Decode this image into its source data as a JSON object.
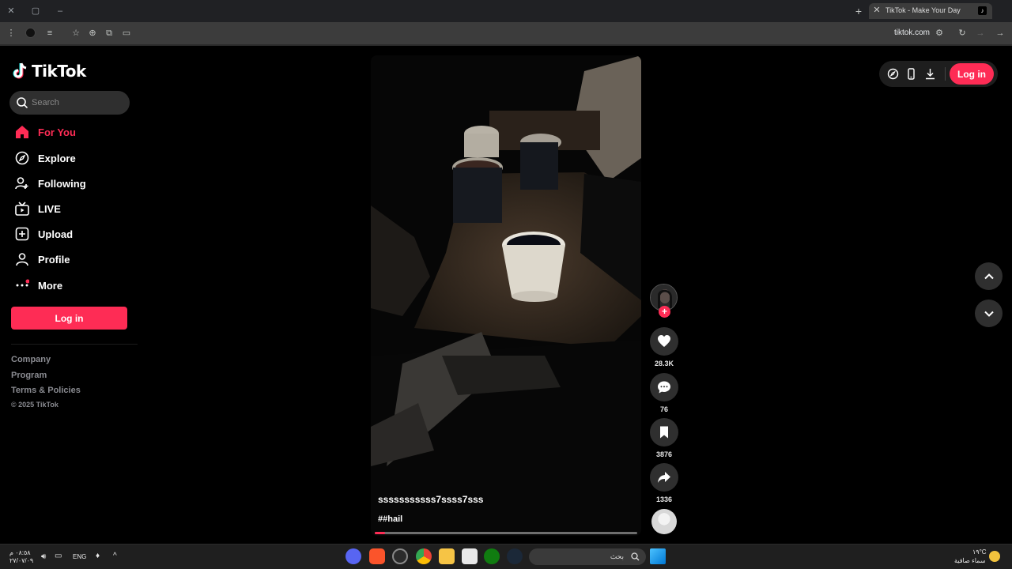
{
  "browser": {
    "tab_title": "TikTok - Make Your Day",
    "url": "tiktok.com"
  },
  "sidebar": {
    "logo_text": "TikTok",
    "search_placeholder": "Search",
    "nav": [
      {
        "label": "For You",
        "icon": "home-icon",
        "active": true
      },
      {
        "label": "Explore",
        "icon": "compass-icon"
      },
      {
        "label": "Following",
        "icon": "user-plus-icon"
      },
      {
        "label": "LIVE",
        "icon": "live-tv-icon"
      },
      {
        "label": "Upload",
        "icon": "upload-icon"
      },
      {
        "label": "Profile",
        "icon": "profile-icon"
      },
      {
        "label": "More",
        "icon": "more-icon"
      }
    ],
    "login_label": "Log in",
    "footer": {
      "company": "Company",
      "program": "Program",
      "terms": "Terms & Policies",
      "copyright": "© 2025 TikTok"
    }
  },
  "video": {
    "username": "sssssssssss7ssss7sss",
    "caption": "##hail",
    "progress": 0.04
  },
  "actions": {
    "likes": "28.3K",
    "comments": "76",
    "bookmarks": "3876",
    "shares": "1336"
  },
  "header": {
    "login_label": "Log in"
  },
  "taskbar": {
    "time": "٠٨:٥٨ م",
    "date": "٢٧/٠٧/٠٩",
    "lang": "ENG",
    "search_text": "بحث",
    "weather_temp": "١٩°C",
    "weather_desc": "سماء صافية"
  },
  "colors": {
    "accent": "#fe2c55",
    "background": "#000000",
    "chip": "#2f2f2f"
  }
}
